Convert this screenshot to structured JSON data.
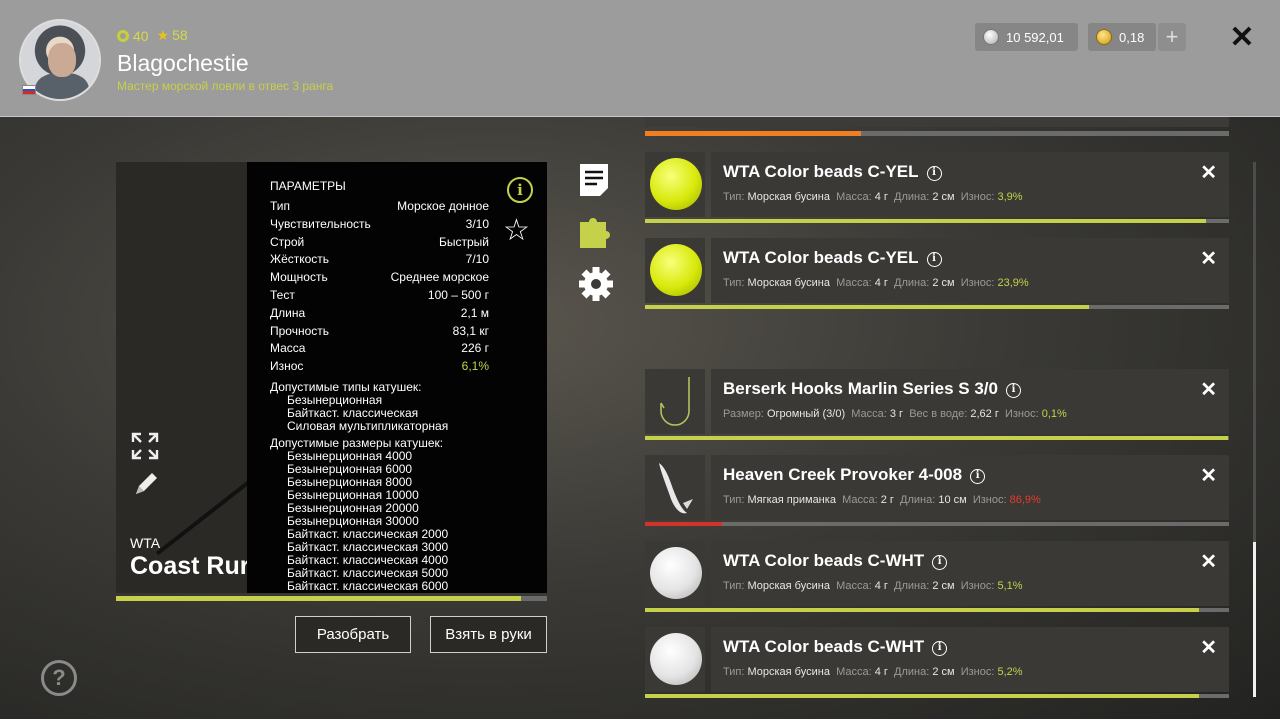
{
  "player": {
    "level": "40",
    "rank": "58",
    "name": "Blagochestie",
    "title": "Мастер морской ловли в отвес 3 ранга"
  },
  "currency": {
    "silver": "10 592,01",
    "gold": "0,18",
    "add_label": "+"
  },
  "rod": {
    "brand": "WTA",
    "name": "Coast Rur",
    "progress": 0.94,
    "params_title": "ПАРАМЕТРЫ",
    "params": [
      {
        "k": "Тип",
        "v": "Морское донное"
      },
      {
        "k": "Чувствительность",
        "v": "3/10"
      },
      {
        "k": "Строй",
        "v": "Быстрый"
      },
      {
        "k": "Жёсткость",
        "v": "7/10"
      },
      {
        "k": "Мощность",
        "v": "Среднее морское"
      },
      {
        "k": "Тест",
        "v": "100 – 500 г"
      },
      {
        "k": "Длина",
        "v": "2,1 м"
      },
      {
        "k": "Прочность",
        "v": "83,1 кг"
      },
      {
        "k": "Масса",
        "v": "226 г"
      },
      {
        "k": "Износ",
        "v": "6,1%"
      }
    ],
    "reel_types_label": "Допустимые типы катушек:",
    "reel_types": [
      "Безынерционная",
      "Байткаст. классическая",
      "Силовая мультипликаторная"
    ],
    "reel_sizes_label": "Допустимые размеры катушек:",
    "reel_sizes": [
      "Безынерционная 4000",
      "Безынерционная 6000",
      "Безынерционная 8000",
      "Безынерционная 10000",
      "Безынерционная 20000",
      "Безынерционная 30000",
      "Байткаст. классическая 2000",
      "Байткаст. классическая 3000",
      "Байткаст. классическая 4000",
      "Байткаст. классическая 5000",
      "Байткаст. классическая 6000"
    ]
  },
  "buttons": {
    "disassemble": "Разобрать",
    "take": "Взять в руки",
    "help": "?"
  },
  "top_partial_wear": 0.37,
  "items": [
    {
      "name": "WTA Color beads C-YEL",
      "thumb": "yellow-bead",
      "meta": [
        [
          "Тип:",
          "Морская бусина"
        ],
        [
          "Масса:",
          "4 г"
        ],
        [
          "Длина:",
          "2 см"
        ]
      ],
      "wear_label": "Износ:",
      "wear": "3,9%",
      "wear_red": false,
      "bar": 0.961
    },
    {
      "name": "WTA Color beads C-YEL",
      "thumb": "yellow-bead",
      "meta": [
        [
          "Тип:",
          "Морская бусина"
        ],
        [
          "Масса:",
          "4 г"
        ],
        [
          "Длина:",
          "2 см"
        ]
      ],
      "wear_label": "Износ:",
      "wear": "23,9%",
      "wear_red": false,
      "bar": 0.761
    },
    {
      "name": "Berserk Hooks Marlin Series S 3/0",
      "thumb": "hook",
      "meta": [
        [
          "Размер:",
          "Огромный (3/0)"
        ],
        [
          "Масса:",
          "3 г"
        ],
        [
          "Вес в воде:",
          "2,62 г"
        ]
      ],
      "wear_label": "Износ:",
      "wear": "0,1%",
      "wear_red": false,
      "bar": 0.999
    },
    {
      "name": "Heaven Creek Provoker 4-008",
      "thumb": "soft-bait",
      "meta": [
        [
          "Тип:",
          "Мягкая приманка"
        ],
        [
          "Масса:",
          "2 г"
        ],
        [
          "Длина:",
          "10 см"
        ]
      ],
      "wear_label": "Износ:",
      "wear": "86,9%",
      "wear_red": true,
      "bar": 0.131
    },
    {
      "name": "WTA Color beads C-WHT",
      "thumb": "white-bead",
      "meta": [
        [
          "Тип:",
          "Морская бусина"
        ],
        [
          "Масса:",
          "4 г"
        ],
        [
          "Длина:",
          "2 см"
        ]
      ],
      "wear_label": "Износ:",
      "wear": "5,1%",
      "wear_red": false,
      "bar": 0.949
    },
    {
      "name": "WTA Color beads C-WHT",
      "thumb": "white-bead",
      "meta": [
        [
          "Тип:",
          "Морская бусина"
        ],
        [
          "Масса:",
          "4 г"
        ],
        [
          "Длина:",
          "2 см"
        ]
      ],
      "wear_label": "Износ:",
      "wear": "5,2%",
      "wear_red": false,
      "bar": 0.948
    }
  ],
  "icons": {
    "close": "close-icon",
    "info": "info-icon",
    "favorite": "star-icon",
    "expand": "expand-icon",
    "edit": "pencil-icon",
    "document": "document-icon",
    "puzzle": "puzzle-icon",
    "settings": "gear-icon"
  },
  "colors": {
    "accent_green": "#c5d14a",
    "wear_red": "#e53b2c",
    "orange_bar": "#f07e22"
  }
}
